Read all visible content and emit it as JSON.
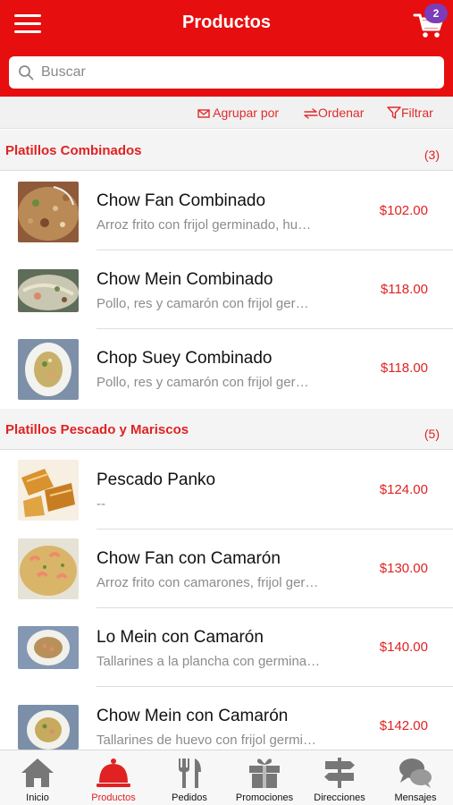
{
  "colors": {
    "brand": "#e60e0e",
    "accent_text": "#e02222",
    "badge": "#7d3cb8"
  },
  "header": {
    "title": "Productos",
    "cart_count": "2",
    "menu_icon": "hamburger-icon",
    "cart_icon": "cart-icon"
  },
  "search": {
    "placeholder": "Buscar",
    "value": ""
  },
  "toolbar": {
    "group_label": "Agrupar por",
    "sort_label": "Ordenar",
    "filter_label": "Filtrar"
  },
  "sections": [
    {
      "title": "Platillos Combinados",
      "count": "(3)",
      "items": [
        {
          "name": "Chow Fan Combinado",
          "desc": "Arroz frito con frijol germinado, hu…",
          "price": "$102.00"
        },
        {
          "name": "Chow Mein Combinado",
          "desc": "Pollo, res y camarón con frijol ger…",
          "price": "$118.00"
        },
        {
          "name": "Chop Suey Combinado",
          "desc": "Pollo, res y camarón con frijol ger…",
          "price": "$118.00"
        }
      ]
    },
    {
      "title": "Platillos Pescado y Mariscos",
      "count": "(5)",
      "items": [
        {
          "name": "Pescado Panko",
          "desc": "--",
          "price": "$124.00"
        },
        {
          "name": "Chow Fan con Camarón",
          "desc": "Arroz frito con camarones, frijol ger…",
          "price": "$130.00"
        },
        {
          "name": "Lo Mein con Camarón",
          "desc": "Tallarines a la plancha con germina…",
          "price": "$140.00"
        },
        {
          "name": "Chow Mein con Camarón",
          "desc": "Tallarines de huevo con frijol germi…",
          "price": "$142.00"
        }
      ]
    }
  ],
  "bottom_nav": [
    {
      "label": "Inicio",
      "icon": "home-icon"
    },
    {
      "label": "Productos",
      "icon": "cloche-icon",
      "active": true
    },
    {
      "label": "Pedidos",
      "icon": "fork-knife-icon"
    },
    {
      "label": "Promociones",
      "icon": "gift-icon"
    },
    {
      "label": "Direcciones",
      "icon": "signpost-icon"
    },
    {
      "label": "Mensajes",
      "icon": "chat-bubbles-icon"
    }
  ]
}
